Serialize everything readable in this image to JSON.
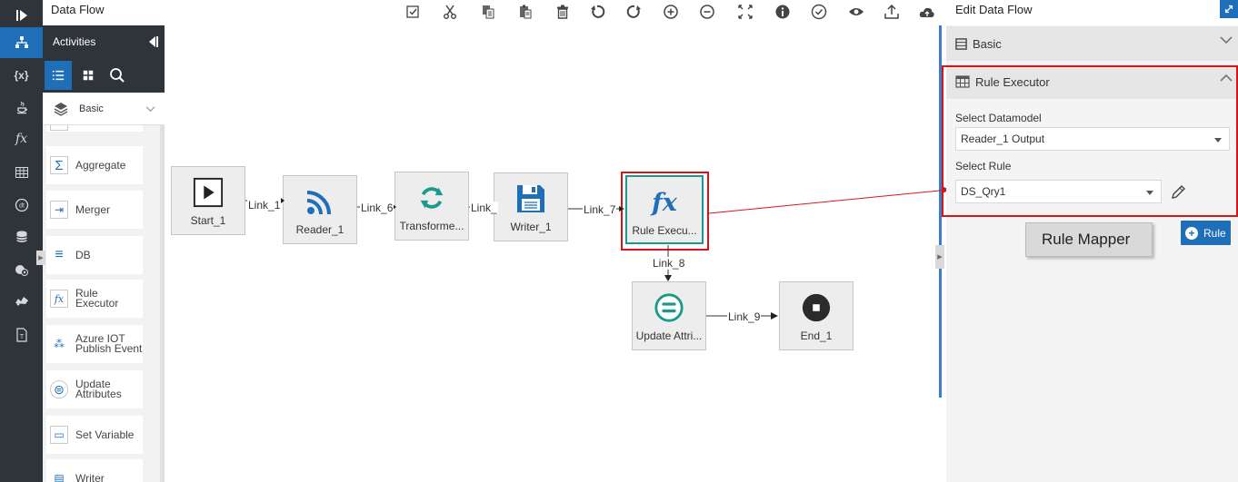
{
  "app": {
    "title": "Data Flow"
  },
  "rail": {
    "items": [
      {
        "name": "collapse-rail-icon",
        "label": ""
      },
      {
        "name": "dataflow-icon",
        "label": ""
      },
      {
        "name": "variables-icon",
        "label": "{x}"
      },
      {
        "name": "java-icon",
        "label": ""
      },
      {
        "name": "function-icon",
        "label": "fx"
      },
      {
        "name": "table-icon",
        "label": ""
      },
      {
        "name": "datetime-icon",
        "label": "dt"
      },
      {
        "name": "database-icon",
        "label": ""
      },
      {
        "name": "settings-db-icon",
        "label": ""
      },
      {
        "name": "integration-icon",
        "label": ""
      },
      {
        "name": "text-file-icon",
        "label": "T"
      }
    ]
  },
  "palette": {
    "title": "Activities",
    "category": "Basic",
    "items": [
      {
        "label": "Aggregate",
        "icon": "Σ"
      },
      {
        "label": "Merger",
        "icon": "⇥"
      },
      {
        "label": "DB",
        "icon": "≡"
      },
      {
        "label": "Rule Executor",
        "icon": "fx"
      },
      {
        "label": "Azure IOT Publish Event",
        "icon": "⁂"
      },
      {
        "label": "Update Attributes",
        "icon": "⊜"
      },
      {
        "label": "Set Variable",
        "icon": "▭"
      },
      {
        "label": "Writer",
        "icon": "▤"
      }
    ]
  },
  "toolbar": {
    "items": [
      "validate",
      "cut",
      "copy",
      "paste",
      "delete",
      "undo",
      "redo",
      "zoom-in",
      "zoom-out",
      "fit",
      "info",
      "check",
      "preview",
      "export",
      "deploy"
    ]
  },
  "canvas": {
    "nodes": [
      {
        "id": "start",
        "label": "Start_1"
      },
      {
        "id": "reader",
        "label": "Reader_1"
      },
      {
        "id": "transformer",
        "label": "Transforme..."
      },
      {
        "id": "writer",
        "label": "Writer_1"
      },
      {
        "id": "rule",
        "label": "Rule Execu..."
      },
      {
        "id": "update",
        "label": "Update Attri..."
      },
      {
        "id": "end",
        "label": "End_1"
      }
    ],
    "links": [
      {
        "label": "Link_1"
      },
      {
        "label": "Link_6"
      },
      {
        "label": "Link_"
      },
      {
        "label": "Link_7"
      },
      {
        "label": "Link_8"
      },
      {
        "label": "Link_9"
      }
    ]
  },
  "panel": {
    "title": "Edit Data Flow",
    "basic_label": "Basic",
    "rule_section_label": "Rule Executor",
    "datamodel_label": "Select Datamodel",
    "datamodel_value": "Reader_1 Output",
    "rule_label": "Select Rule",
    "rule_value": "DS_Qry1",
    "add_rule_label": "Rule"
  },
  "callout": {
    "text": "Rule Mapper"
  },
  "colors": {
    "accent": "#1e6fb7",
    "highlight": "#d8141b",
    "teal": "#1a9a8c",
    "rail": "#2f343b"
  }
}
